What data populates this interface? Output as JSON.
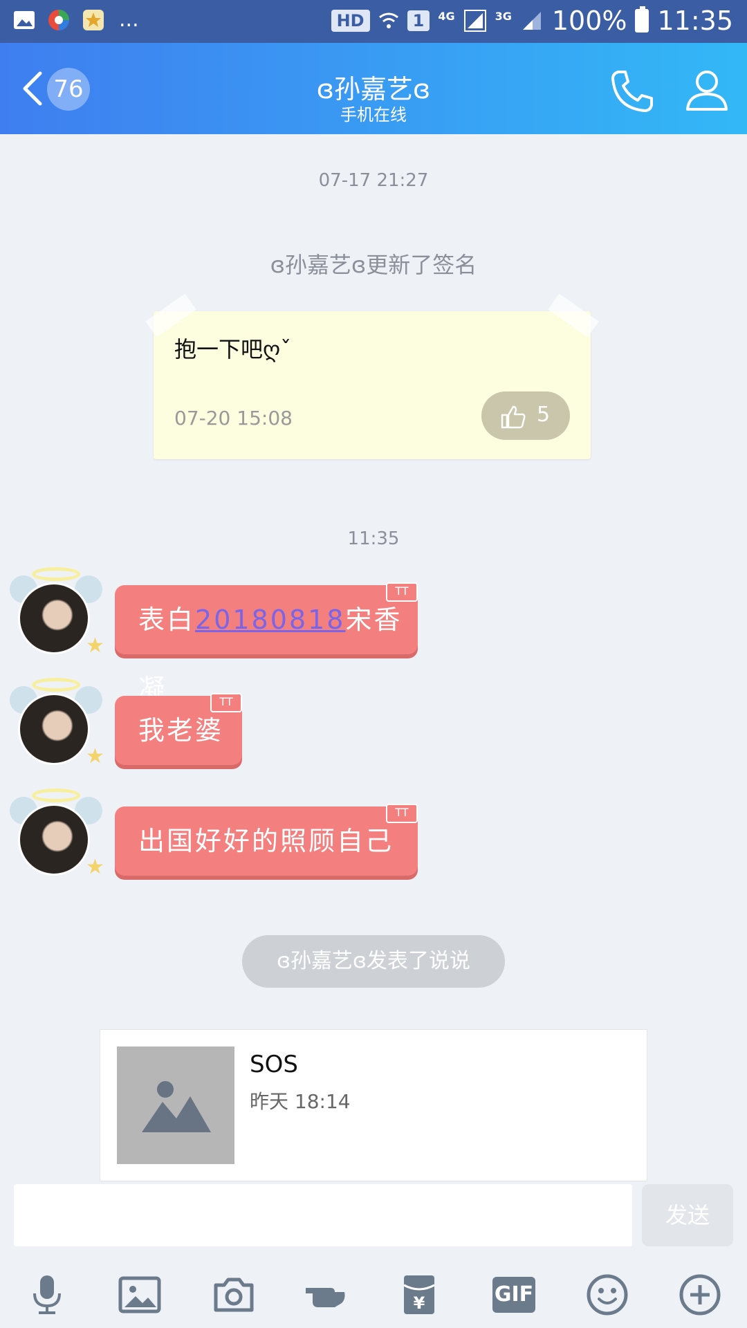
{
  "status_bar": {
    "hd": "HD",
    "sim": "1",
    "net1": "4G",
    "net2": "3G",
    "battery": "100%",
    "time": "11:35",
    "more": "..."
  },
  "header": {
    "back_count": "76",
    "title": "ɞ孙嘉艺ɞ",
    "subtitle": "手机在线"
  },
  "chat": {
    "time1": "07-17 21:27",
    "signature_notice": "ɞ孙嘉艺ɞ更新了签名",
    "signature_card": {
      "text": "抱一下吧ღˇ",
      "time": "07-20 15:08",
      "likes": "5"
    },
    "time2": "11:35",
    "messages": [
      {
        "pre": "表白",
        "link": "20180818",
        "post": "宋香凝"
      },
      {
        "text": "我老婆"
      },
      {
        "text": "出国好好的照顾自己"
      }
    ],
    "bubble_tag": "TT",
    "post_notice": "ɞ孙嘉艺ɞ发表了说说",
    "share_card": {
      "title": "SOS",
      "time": "昨天 18:14"
    }
  },
  "input": {
    "placeholder": "",
    "send_label": "发送"
  },
  "toolbar": {
    "gif_label": "GIF"
  },
  "colors": {
    "header_start": "#3f7ef0",
    "header_end": "#33b8f6",
    "bubble": "#f47f7f",
    "signature_card": "#fdfde0"
  }
}
